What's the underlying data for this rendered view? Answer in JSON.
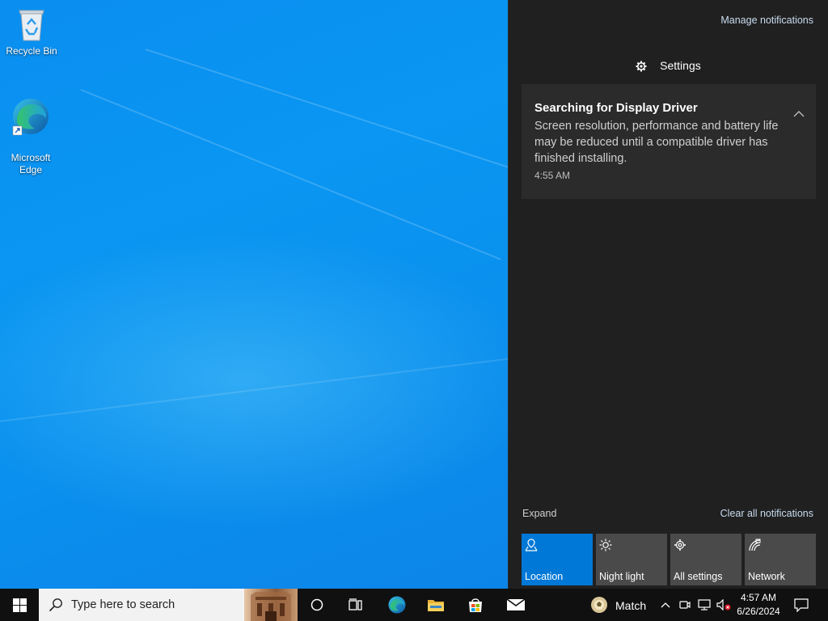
{
  "desktop": {
    "icons": [
      {
        "label": "Recycle Bin"
      },
      {
        "label": "Microsoft\nEdge"
      }
    ]
  },
  "action_center": {
    "manage_link": "Manage notifications",
    "group_title": "Settings",
    "notification": {
      "title": "Searching for Display Driver",
      "body": "Screen resolution, performance and battery life may be reduced until a compatible driver has finished installing.",
      "time": "4:55 AM"
    },
    "expand_link": "Expand",
    "clear_link": "Clear all notifications",
    "quick_actions": [
      {
        "label": "Location",
        "icon": "location-icon",
        "active": true
      },
      {
        "label": "Night light",
        "icon": "night-light-icon",
        "active": false
      },
      {
        "label": "All settings",
        "icon": "gear-icon",
        "active": false
      },
      {
        "label": "Network",
        "icon": "network-icon",
        "active": false
      }
    ],
    "accent_color": "#0078d7"
  },
  "taskbar": {
    "search_placeholder": "Type here to search",
    "pinned": [
      "cortana-icon",
      "task-view-icon",
      "edge-icon",
      "file-explorer-icon",
      "store-icon",
      "mail-icon"
    ],
    "widget_label": "Match",
    "clock": {
      "time": "4:57 AM",
      "date": "6/26/2024"
    }
  }
}
